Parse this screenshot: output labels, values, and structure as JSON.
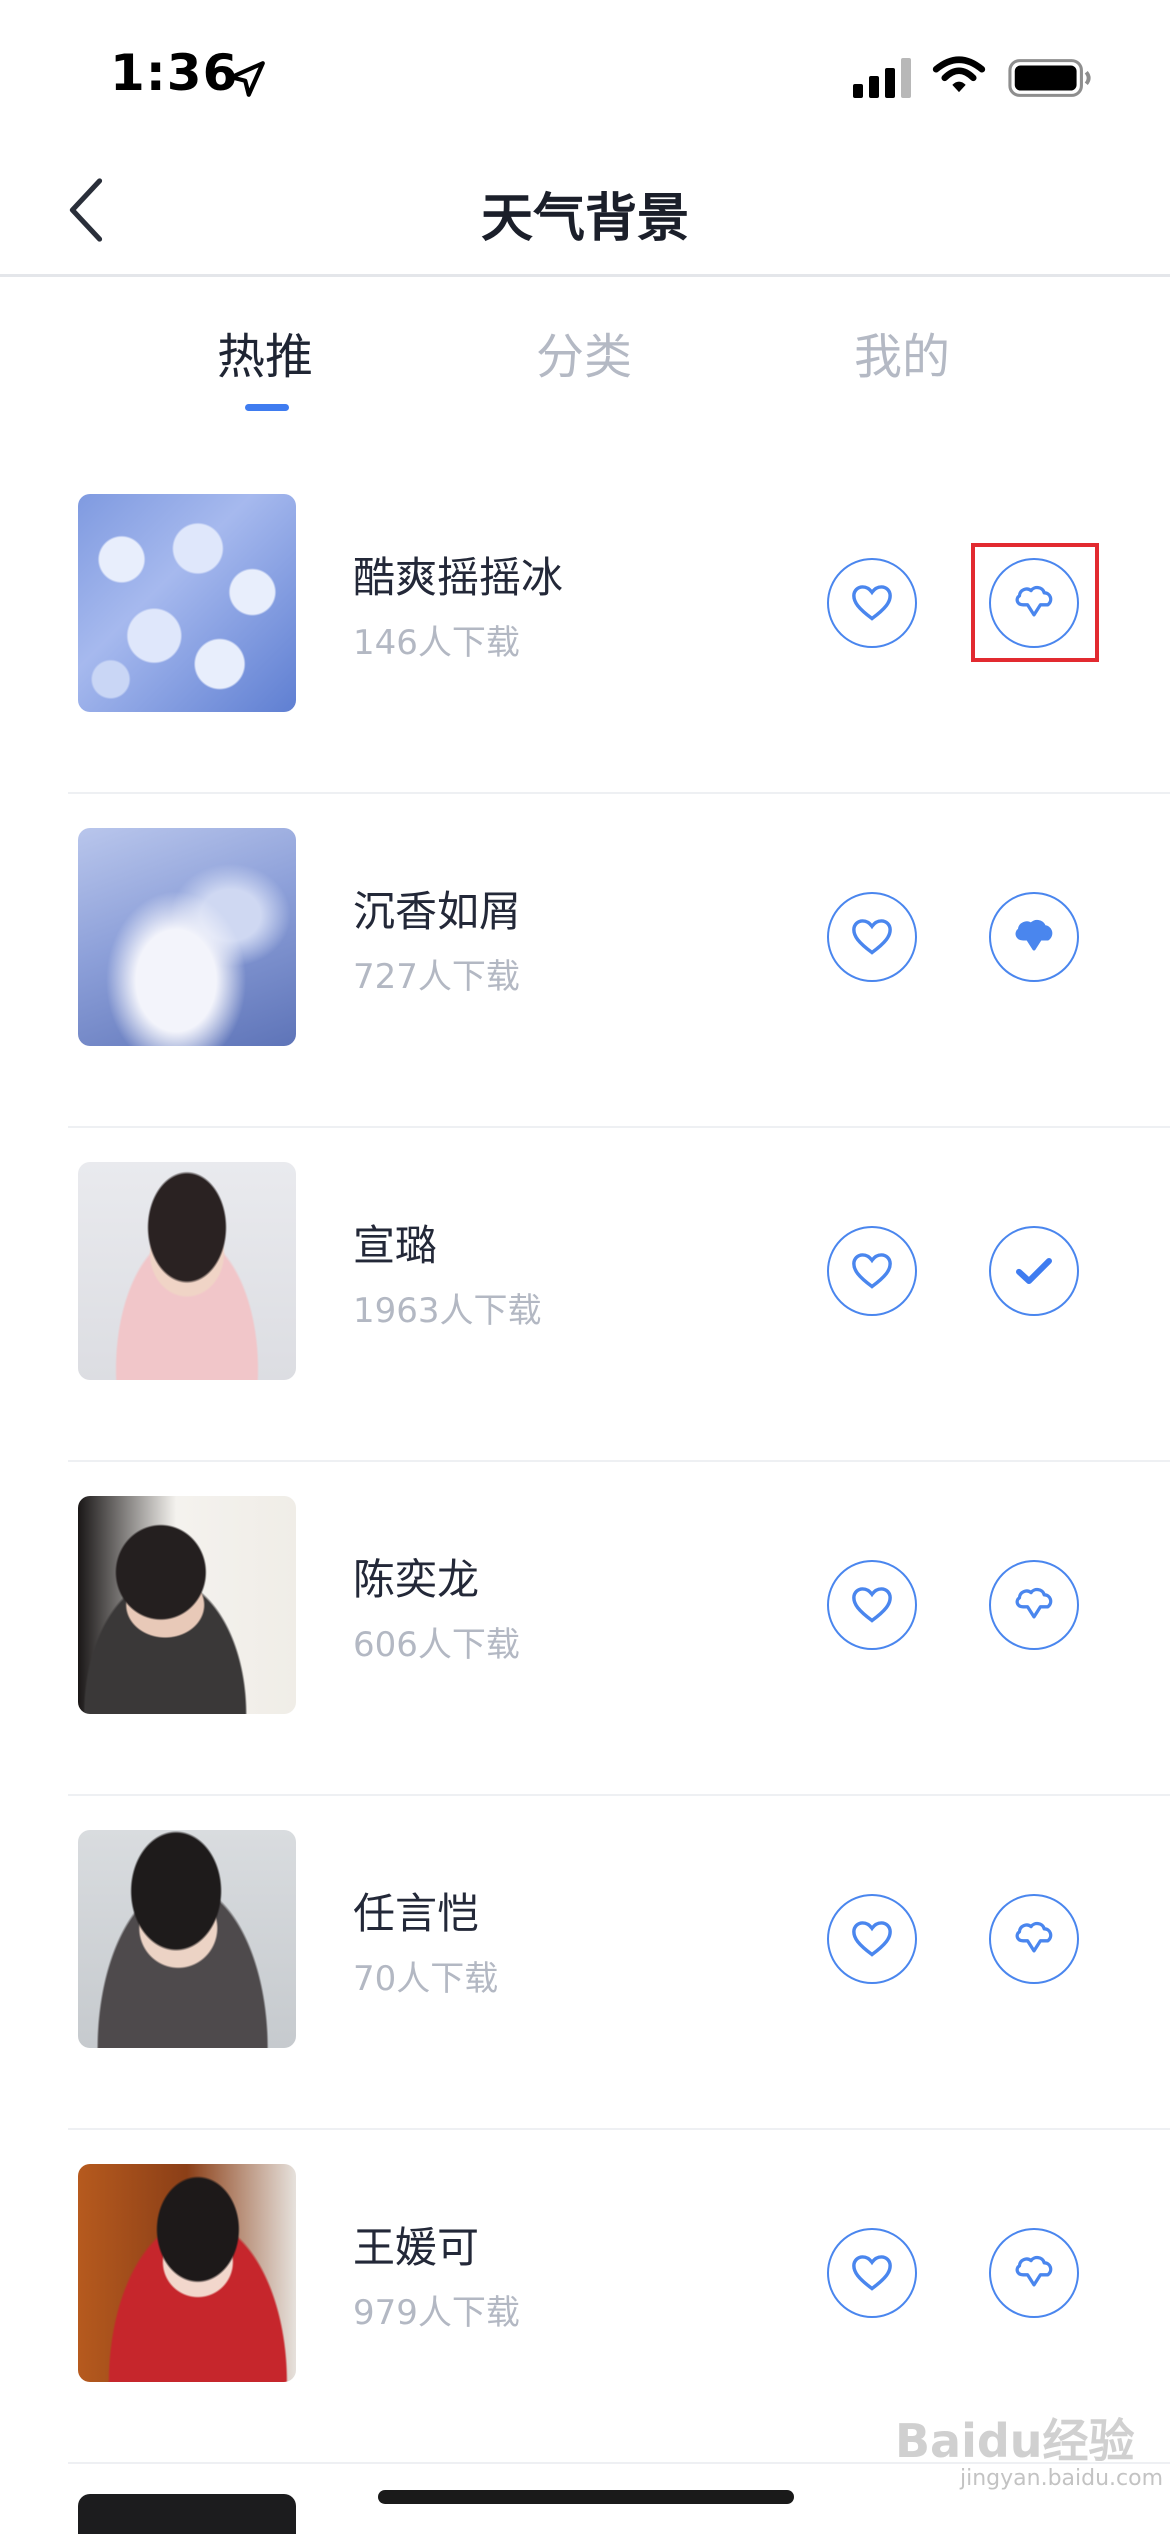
{
  "status_bar": {
    "time": "1:36"
  },
  "nav": {
    "title": "天气背景"
  },
  "tabs": [
    {
      "label": "热推",
      "active": true
    },
    {
      "label": "分类",
      "active": false
    },
    {
      "label": "我的",
      "active": false
    }
  ],
  "colors": {
    "accent": "#3f7cf0",
    "highlight": "#e22a30"
  },
  "items": [
    {
      "title": "酷爽摇摇冰",
      "downloads": "146人下载",
      "status": "not-downloaded"
    },
    {
      "title": "沉香如屑",
      "downloads": "727人下载",
      "status": "downloading"
    },
    {
      "title": "宣璐",
      "downloads": "1963人下载",
      "status": "downloaded"
    },
    {
      "title": "陈奕龙",
      "downloads": "606人下载",
      "status": "not-downloaded"
    },
    {
      "title": "任言恺",
      "downloads": "70人下载",
      "status": "not-downloaded"
    },
    {
      "title": "王媛可",
      "downloads": "979人下载",
      "status": "not-downloaded"
    }
  ],
  "watermark": {
    "text": "Baidu经验",
    "sub": "jingyan.baidu.com"
  }
}
